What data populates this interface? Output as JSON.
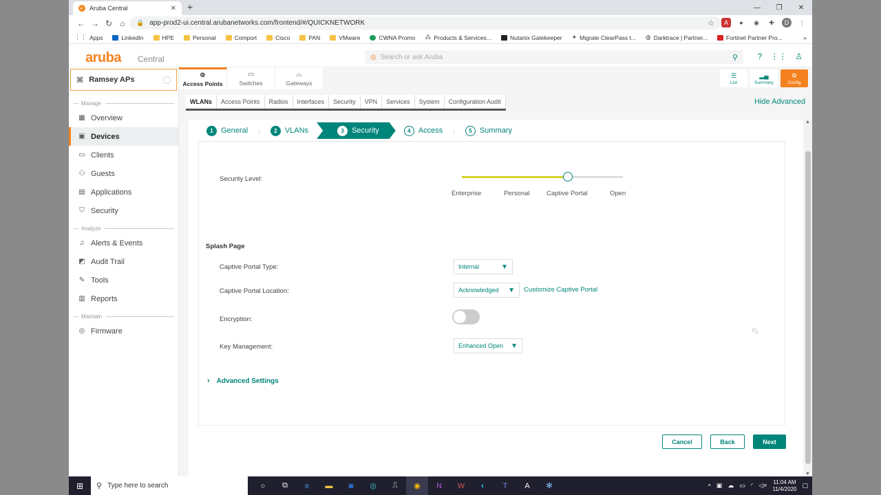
{
  "browser": {
    "tab_title": "Aruba Central",
    "tab_close": "✕",
    "new_tab": "+",
    "url": "app-prod2-ui.central.arubanetworks.com/frontend/#/QUICKNETWORK",
    "profile_initial": "D",
    "bookmarks": [
      "Apps",
      "LinkedIn",
      "HPE",
      "Personal",
      "Comport",
      "Cisco",
      "PAN",
      "VMware",
      "CWNA Promo",
      "Products & Services...",
      "Nutanix Gatekeeper",
      "Migrate ClearPass t...",
      "Darktrace | Partner...",
      "Fortinet Partner Pro..."
    ],
    "bookmarks_more": "»"
  },
  "app": {
    "brand": "aruba",
    "brand_sub": "Central",
    "search_placeholder": "Search or ask Aruba"
  },
  "sidebar": {
    "group": "Ramsey APs",
    "sections": {
      "manage": "Manage",
      "analyze": "Analyze",
      "maintain": "Maintain"
    },
    "items": {
      "overview": "Overview",
      "devices": "Devices",
      "clients": "Clients",
      "guests": "Guests",
      "applications": "Applications",
      "security": "Security",
      "alerts": "Alerts & Events",
      "audit": "Audit Trail",
      "tools": "Tools",
      "reports": "Reports",
      "firmware": "Firmware"
    }
  },
  "device_tabs": {
    "access_points": "Access Points",
    "switches": "Switches",
    "gateways": "Gateways"
  },
  "view_buttons": {
    "list": "List",
    "summary": "Summary",
    "config": "Config"
  },
  "subtabs": [
    "WLANs",
    "Access Points",
    "Radios",
    "Interfaces",
    "Security",
    "VPN",
    "Services",
    "System",
    "Configuration Audit"
  ],
  "hide_advanced": "Hide Advanced",
  "wizard": {
    "steps": [
      {
        "num": "1",
        "label": "General"
      },
      {
        "num": "2",
        "label": "VLANs"
      },
      {
        "num": "3",
        "label": "Security"
      },
      {
        "num": "4",
        "label": "Access"
      },
      {
        "num": "5",
        "label": "Summary"
      }
    ]
  },
  "form": {
    "security_level_label": "Security Level:",
    "security_levels": [
      "Enterprise",
      "Personal",
      "Captive Portal",
      "Open"
    ],
    "security_level_value": 0.66,
    "splash_page": "Splash Page",
    "captive_portal_type_label": "Captive Portal Type:",
    "captive_portal_type": "Internal",
    "captive_portal_location_label": "Captive Portal Location:",
    "captive_portal_location": "Acknowledged",
    "customize_link": "Customize Captive Portal",
    "encryption_label": "Encryption:",
    "encryption_on": false,
    "key_management_label": "Key Management:",
    "key_management": "Enhanced Open",
    "advanced_settings": "Advanced Settings"
  },
  "buttons": {
    "cancel": "Cancel",
    "back": "Back",
    "next": "Next"
  },
  "taskbar": {
    "search_placeholder": "Type here to search",
    "time": "11:04 AM",
    "date": "11/4/2020"
  }
}
